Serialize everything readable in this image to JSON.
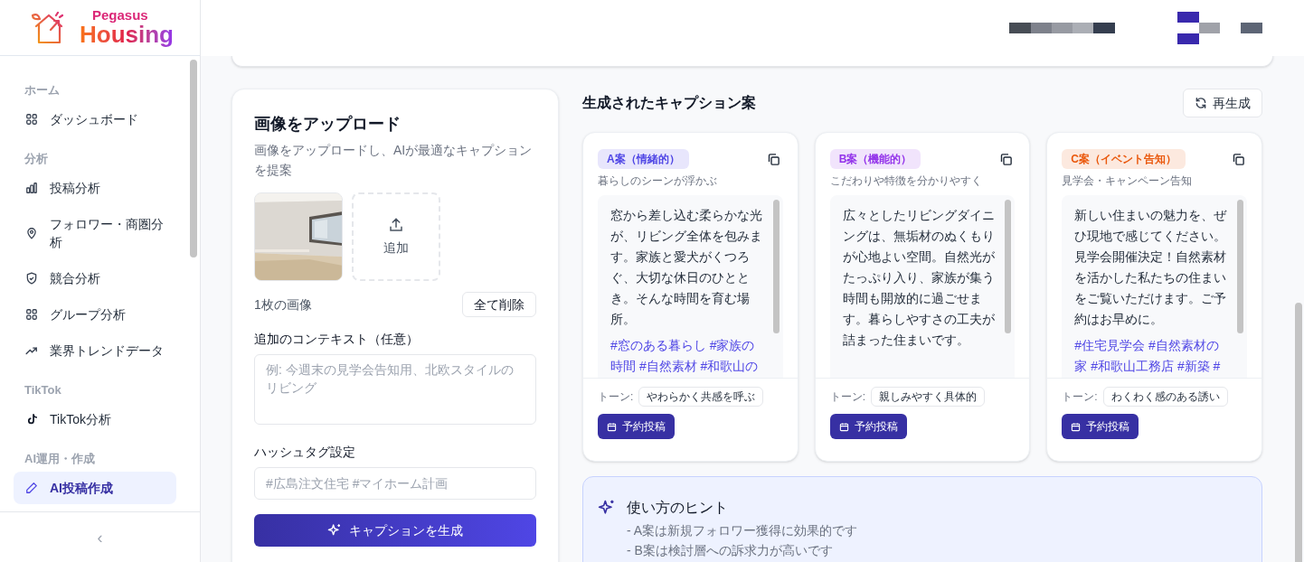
{
  "brand": {
    "line_1": "Pegasus",
    "line_2": "Housing"
  },
  "sidebar": {
    "sections": [
      {
        "title": "ホーム",
        "items": [
          {
            "label": "ダッシュボード",
            "selected": false
          }
        ]
      },
      {
        "title": "分析",
        "items": [
          {
            "label": "投稿分析",
            "selected": false
          },
          {
            "label": "フォロワー・商圏分析",
            "selected": false
          },
          {
            "label": "競合分析",
            "selected": false
          },
          {
            "label": "グループ分析",
            "selected": false
          },
          {
            "label": "業界トレンドデータ",
            "selected": false
          }
        ]
      },
      {
        "title": "TikTok",
        "items": [
          {
            "label": "TikTok分析",
            "selected": false
          }
        ]
      },
      {
        "title": "AI運用・作成",
        "items": [
          {
            "label": "AI投稿作成",
            "selected": true
          }
        ]
      }
    ],
    "collapse": "‹"
  },
  "upload": {
    "title": "画像をアップロード",
    "subtitle": "画像をアップロードし、AIが最適なキャプションを提案",
    "add_label": "追加",
    "count": "1枚の画像",
    "clear_button": "全て削除",
    "context": {
      "label": "追加のコンテキスト（任意）",
      "placeholder": "例: 今週末の見学会告知用、北欧スタイルのリビング"
    },
    "hashtags": {
      "label": "ハッシュタグ設定",
      "placeholder": "#広島注文住宅 #マイホーム計画"
    },
    "generate_button": "キャプションを生成"
  },
  "results": {
    "title": "生成されたキャプション案",
    "regenerate_button": "再生成",
    "cards": [
      {
        "badge": "A案（情緒的）",
        "color": "#4f46e5",
        "description": "暮らしのシーンが浮かぶ",
        "body": "窓から差し込む柔らかな光が、リビング全体を包みます。家族と愛犬がくつろぐ、大切な休日のひととき。そんな時間を育む場所。",
        "hashtags": "#窓のある暮らし #家族の時間 #自然素材 #和歌山の",
        "tone_label": "トーン:",
        "tone": "やわらかく共感を呼ぶ",
        "schedule_button": "予約投稿"
      },
      {
        "badge": "B案（機能的）",
        "color": "#9333ea",
        "description": "こだわりや特徴を分かりやすく",
        "body": "広々としたリビングダイニングは、無垢材のぬくもりが心地よい空間。自然光がたっぷり入り、家族が集う時間も開放的に過ごせます。暮らしやすさの工夫が詰まった住まいです。",
        "tone_label": "トーン:",
        "tone": "親しみやすく具体的",
        "schedule_button": "予約投稿"
      },
      {
        "badge": "C案（イベント告知）",
        "color": "#ea580c",
        "description": "見学会・キャンペーン告知",
        "body": "新しい住まいの魅力を、ぜひ現地で感じてください。見学会開催決定！自然素材を活かした私たちの住まいをご覧いただけます。ご予約はお早めに。",
        "hashtags": "#住宅見学会 #自然素材の家 #和歌山工務店 #新築 #",
        "tone_label": "トーン:",
        "tone": "わくわく感のある誘い",
        "schedule_button": "予約投稿"
      }
    ]
  },
  "tips": {
    "title": "使い方のヒント",
    "lines": [
      "- A案は新規フォロワー獲得に効果的です",
      "- B案は検討層への訴求力が高いです"
    ]
  }
}
